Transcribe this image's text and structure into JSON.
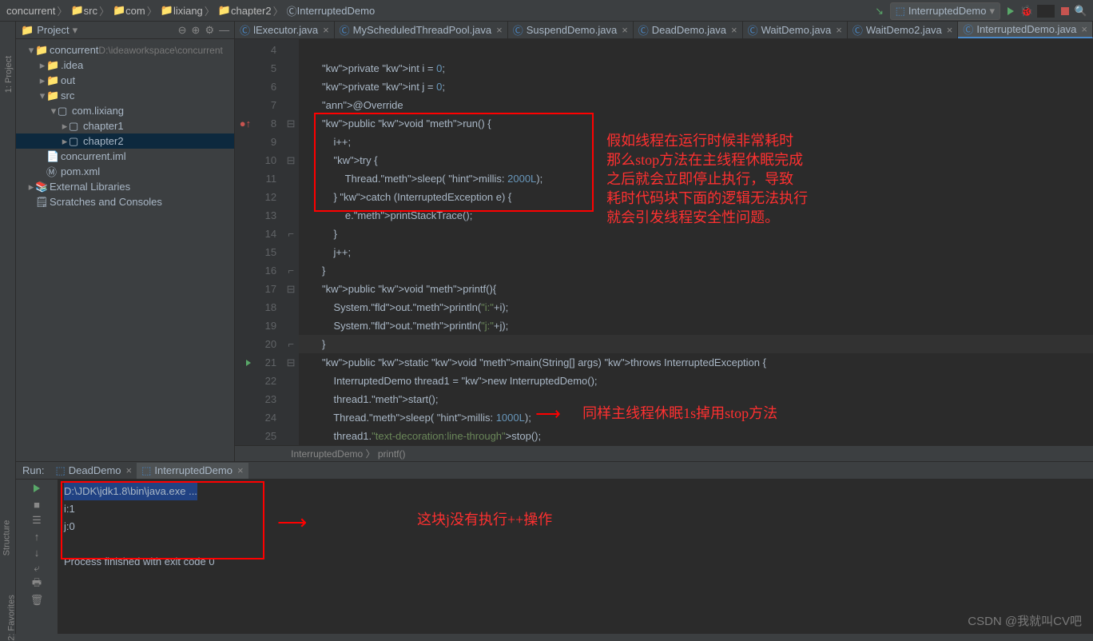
{
  "breadcrumbs": [
    "concurrent",
    "src",
    "com",
    "lixiang",
    "chapter2",
    "InterruptedDemo"
  ],
  "runConfig": "InterruptedDemo",
  "project": {
    "title": "Project",
    "root": "concurrent",
    "rootPath": "D:\\ideaworkspace\\concurrent",
    "nodes": [
      {
        "indent": 1,
        "arrow": "▾",
        "icon": "folder",
        "label": "concurrent",
        "suffix": " D:\\ideaworkspace\\concurrent"
      },
      {
        "indent": 2,
        "arrow": "▸",
        "icon": "folder-grey",
        "label": ".idea"
      },
      {
        "indent": 2,
        "arrow": "▸",
        "icon": "folder-grey",
        "label": "out"
      },
      {
        "indent": 2,
        "arrow": "▾",
        "icon": "folder-blue",
        "label": "src"
      },
      {
        "indent": 3,
        "arrow": "▾",
        "icon": "package",
        "label": "com.lixiang"
      },
      {
        "indent": 4,
        "arrow": "▸",
        "icon": "package",
        "label": "chapter1"
      },
      {
        "indent": 4,
        "arrow": "▸",
        "icon": "package",
        "label": "chapter2",
        "sel": true
      },
      {
        "indent": 2,
        "arrow": "",
        "icon": "file",
        "label": "concurrent.iml"
      },
      {
        "indent": 2,
        "arrow": "",
        "icon": "file-m",
        "label": "pom.xml"
      },
      {
        "indent": 1,
        "arrow": "▸",
        "icon": "lib",
        "label": "External Libraries"
      },
      {
        "indent": 1,
        "arrow": "",
        "icon": "scratch",
        "label": "Scratches and Consoles"
      }
    ]
  },
  "tabs": [
    {
      "label": "lExecutor.java"
    },
    {
      "label": "MyScheduledThreadPool.java"
    },
    {
      "label": "SuspendDemo.java"
    },
    {
      "label": "DeadDemo.java"
    },
    {
      "label": "WaitDemo.java"
    },
    {
      "label": "WaitDemo2.java"
    },
    {
      "label": "InterruptedDemo.java",
      "active": true
    }
  ],
  "code": {
    "startLine": 4,
    "lines": [
      "",
      "        private int i = 0;",
      "        private int j = 0;",
      "        @Override",
      "        public void run() {",
      "            i++;",
      "            try {",
      "                Thread.sleep( millis: 2000L);",
      "            } catch (InterruptedException e) {",
      "                e.printStackTrace();",
      "            }",
      "            j++;",
      "        }",
      "        public void printf(){",
      "            System.out.println(\"i:\"+i);",
      "            System.out.println(\"j:\"+j);",
      "        }",
      "        public static void main(String[] args) throws InterruptedException {",
      "            InterruptedDemo thread1 = new InterruptedDemo();",
      "            thread1.start();",
      "            Thread.sleep( millis: 1000L);",
      "            thread1.stop();"
    ]
  },
  "annotations": {
    "text1": "假如线程在运行时候非常耗时\n那么stop方法在主线程休眠完成\n之后就会立即停止执行，导致\n耗时代码块下面的逻辑无法执行\n就会引发线程安全性问题。",
    "text2": "同样主线程休眠1s掉用stop方法",
    "text3": "这块j没有执行++操作"
  },
  "breadcrumb2": "InterruptedDemo 〉 printf()",
  "runPanel": {
    "title": "Run:",
    "tabs": [
      {
        "label": "DeadDemo"
      },
      {
        "label": "InterruptedDemo",
        "active": true
      }
    ],
    "output": [
      "D:\\JDK\\jdk1.8\\bin\\java.exe ...",
      "i:1",
      "j:0",
      "",
      "Process finished with exit code 0"
    ]
  },
  "watermark": "CSDN @我就叫CV吧"
}
